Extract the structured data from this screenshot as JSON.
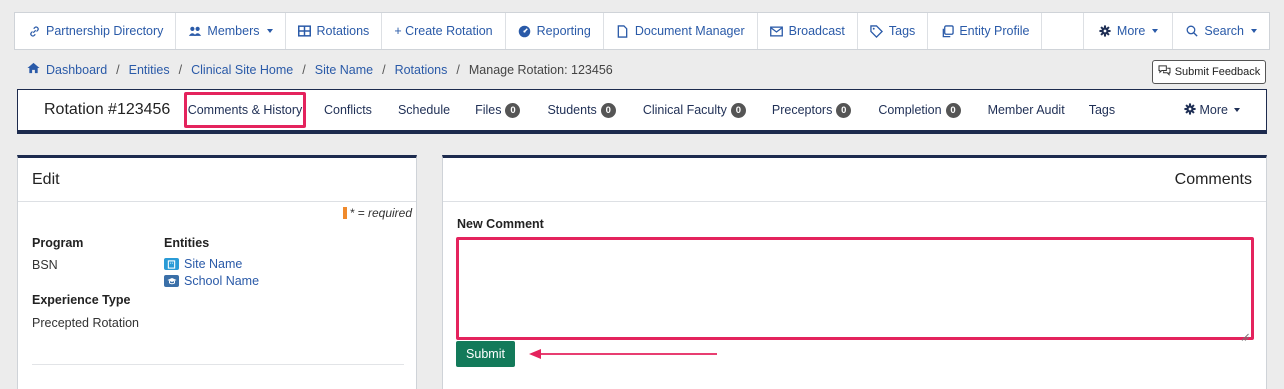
{
  "topnav": {
    "items": [
      {
        "label": "Partnership Directory",
        "icon": "link-icon"
      },
      {
        "label": "Members",
        "icon": "members-icon",
        "dropdown": true
      },
      {
        "label": "Rotations",
        "icon": "grid-icon"
      },
      {
        "label": "+ Create Rotation",
        "icon": ""
      },
      {
        "label": "Reporting",
        "icon": "gauge-icon"
      },
      {
        "label": "Document Manager",
        "icon": "document-icon"
      },
      {
        "label": "Broadcast",
        "icon": "envelope-icon"
      },
      {
        "label": "Tags",
        "icon": "tag-icon"
      },
      {
        "label": "Entity Profile",
        "icon": "copy-icon"
      }
    ],
    "more": "More",
    "search": "Search"
  },
  "breadcrumb": {
    "items": [
      "Dashboard",
      "Entities",
      "Clinical Site Home",
      "Site Name",
      "Rotations"
    ],
    "current": "Manage Rotation: 123456"
  },
  "feedback_button": "Submit Feedback",
  "rotation": {
    "title": "Rotation #123456",
    "active_tab": "Comments & History",
    "tabs": [
      {
        "label": "Conflicts"
      },
      {
        "label": "Schedule"
      },
      {
        "label": "Files",
        "badge": "0"
      },
      {
        "label": "Students",
        "badge": "0"
      },
      {
        "label": "Clinical Faculty",
        "badge": "0"
      },
      {
        "label": "Preceptors",
        "badge": "0"
      },
      {
        "label": "Completion",
        "badge": "0"
      },
      {
        "label": "Member Audit"
      },
      {
        "label": "Tags"
      }
    ],
    "more": "More"
  },
  "edit_panel": {
    "title": "Edit",
    "required_note": "* = required",
    "program_label": "Program",
    "program_value": "BSN",
    "entities_label": "Entities",
    "entities": [
      "Site Name",
      "School Name"
    ],
    "experience_label": "Experience Type",
    "experience_value": "Precepted Rotation"
  },
  "comments_panel": {
    "title": "Comments",
    "new_comment_label": "New Comment",
    "comment_value": "",
    "submit_label": "Submit"
  },
  "colors": {
    "link": "#2a5aa8",
    "navy": "#1d2b4e",
    "highlight": "#e4235d",
    "submit": "#137a5a",
    "required": "#f08a2c"
  }
}
